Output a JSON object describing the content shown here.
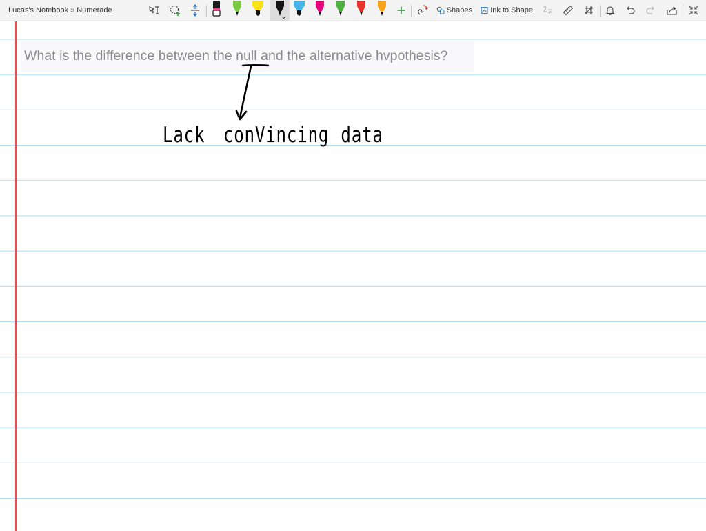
{
  "app": {
    "breadcrumb": {
      "notebook": "Lucas's Notebook",
      "separator": "»",
      "section": "Numerade"
    }
  },
  "toolbar": {
    "tools": [
      {
        "name": "lasso-type-select",
        "icon": "lasso-text-icon"
      },
      {
        "name": "lasso-select",
        "icon": "lasso-add-icon"
      },
      {
        "name": "add-space",
        "icon": "add-space-icon"
      }
    ],
    "pens": [
      {
        "name": "eraser",
        "icon": "eraser-icon",
        "color": "#1a1a1a",
        "tip": "#ffffff"
      },
      {
        "name": "pen-green",
        "icon": "pen-icon",
        "color": "#7ac943",
        "tip": "#111111"
      },
      {
        "name": "highlighter-yellow",
        "icon": "highlighter-icon",
        "color": "#ffe11a",
        "tip": "#111111"
      },
      {
        "name": "pen-black",
        "icon": "pen-icon",
        "color": "#111111",
        "tip": "#111111",
        "selected": true
      },
      {
        "name": "highlighter-blue",
        "icon": "highlighter-icon",
        "color": "#47b4e8",
        "tip": "#111111"
      },
      {
        "name": "pen-magenta",
        "icon": "pen-icon",
        "color": "#e6007e",
        "tip": "#111111"
      },
      {
        "name": "pen-green-2",
        "icon": "pen-icon",
        "color": "#4caf3e",
        "tip": "#111111"
      },
      {
        "name": "pen-red",
        "icon": "pen-icon",
        "color": "#e8322b",
        "tip": "#111111"
      },
      {
        "name": "pen-orange",
        "icon": "pen-icon",
        "color": "#f6a21a",
        "tip": "#111111"
      }
    ],
    "add_pen_icon": "plus-icon",
    "ink_replay_icon": "ink-replay-icon",
    "shapes_label": "Shapes",
    "ink_to_shape_label": "Ink to Shape",
    "right_icons": [
      "ink-to-math-icon",
      "ruler-icon",
      "settings-grid-icon",
      "bell-icon",
      "undo-icon",
      "redo-icon",
      "share-icon",
      "fullscreen-icon"
    ]
  },
  "page": {
    "question": "What is the difference between the null and the alternative hvpothesis?",
    "handwriting": {
      "words": [
        "Lack",
        "conVincing",
        "data"
      ]
    }
  },
  "colors": {
    "toolbar_bg": "#f3f3f3",
    "rule_line": "#aadcf3",
    "margin_line": "#ef4b4b",
    "question_text": "#8a8a8a",
    "ink": "#000000"
  }
}
